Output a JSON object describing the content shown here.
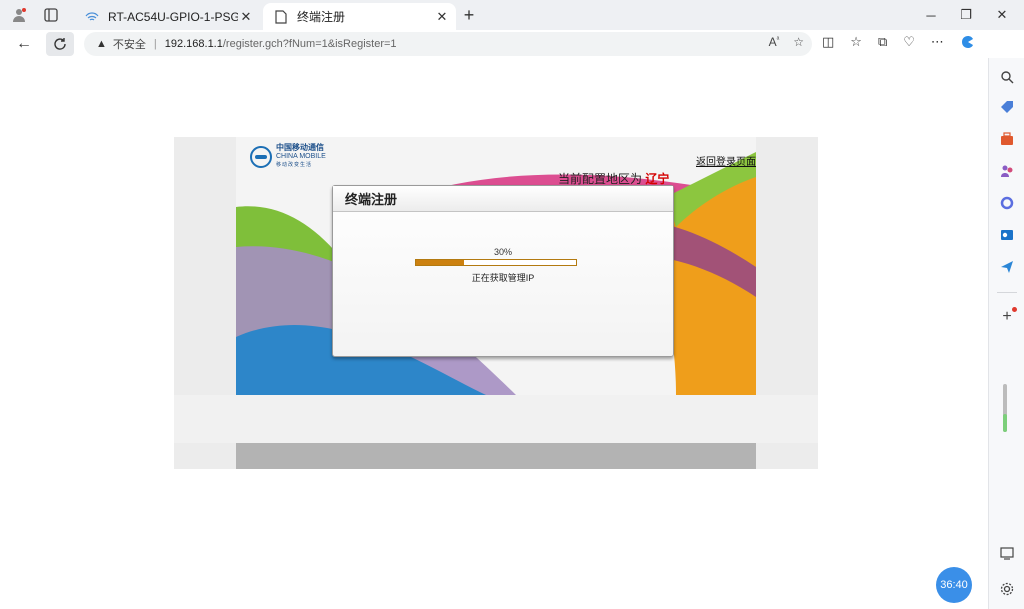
{
  "browser": {
    "tabs": [
      {
        "label": "RT-AC54U-GPIO-1-PSG1208-64M",
        "active": false,
        "icon": "router-tab-icon"
      },
      {
        "label": "终端注册",
        "active": true,
        "icon": "page-icon"
      }
    ],
    "new_tab_label": "+",
    "address": {
      "warning": "不安全",
      "host": "192.168.1.1",
      "path": "/register.gch?fNum=1&isRegister=1"
    }
  },
  "page": {
    "logo": {
      "cn": "中国移动通信",
      "en": "CHINA MOBILE",
      "sub": "移动改变生活"
    },
    "return_link": "返回登录页面",
    "region_label": "当前配置地区为",
    "region_name": "辽宁",
    "dialog": {
      "title": "终端注册",
      "progress_text": "30%",
      "progress_value": 0.3,
      "status": "正在获取管理IP"
    }
  },
  "overlay": {
    "timer": "36:40"
  },
  "colors": {
    "accent_progress": "#cc8110",
    "region_highlight": "#d40000",
    "brand_blue": "#1c6fb5"
  }
}
